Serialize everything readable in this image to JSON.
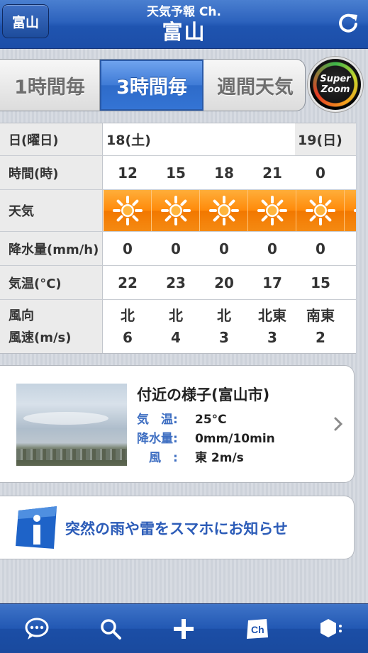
{
  "header": {
    "location_button": "富山",
    "subtitle": "天気予報 Ch.",
    "title": "富山",
    "refresh_icon": "refresh-icon"
  },
  "tabs": [
    {
      "label": "1時間毎",
      "active": false
    },
    {
      "label": "3時間毎",
      "active": true
    },
    {
      "label": "週間天気",
      "active": false
    }
  ],
  "super_zoom": {
    "line1": "Super",
    "line2": "Zoom"
  },
  "table": {
    "labels": {
      "day": "日(曜日)",
      "time": "時間(時)",
      "weather": "天気",
      "precip": "降水量(mm/h)",
      "temp": "気温(°C)",
      "wind_dir": "風向",
      "wind_speed": "風速(m/s)"
    },
    "dates": [
      "18(土)",
      "19(日)"
    ],
    "hours": [
      "12",
      "15",
      "18",
      "21",
      "0"
    ],
    "weather_icons": [
      "sun-icon",
      "sun-icon",
      "sun-icon",
      "sun-icon",
      "sun-icon"
    ],
    "precip": [
      "0",
      "0",
      "0",
      "0",
      "0"
    ],
    "temps": [
      "22",
      "23",
      "20",
      "17",
      "15"
    ],
    "wind_dirs": [
      "北",
      "北",
      "北",
      "北東",
      "南東"
    ],
    "wind_speeds": [
      "6",
      "4",
      "3",
      "3",
      "2"
    ]
  },
  "camera": {
    "title": "付近の様子(富山市)",
    "temp_label": "気　温:",
    "temp_value": "25°C",
    "precip_label": "降水量:",
    "precip_value": "0mm/10min",
    "wind_label": "　風　:",
    "wind_value": "東 2m/s"
  },
  "info_banner": {
    "text": "突然の雨や雷をスマホにお知らせ"
  },
  "tabbar": [
    "chat-bubble-icon",
    "search-icon",
    "plus-icon",
    "channel-icon",
    "settings-hex-icon"
  ],
  "colors": {
    "header_blue": "#2c62bd",
    "orange": "#ff8a0a",
    "accent_text_blue": "#2c5cb8"
  }
}
